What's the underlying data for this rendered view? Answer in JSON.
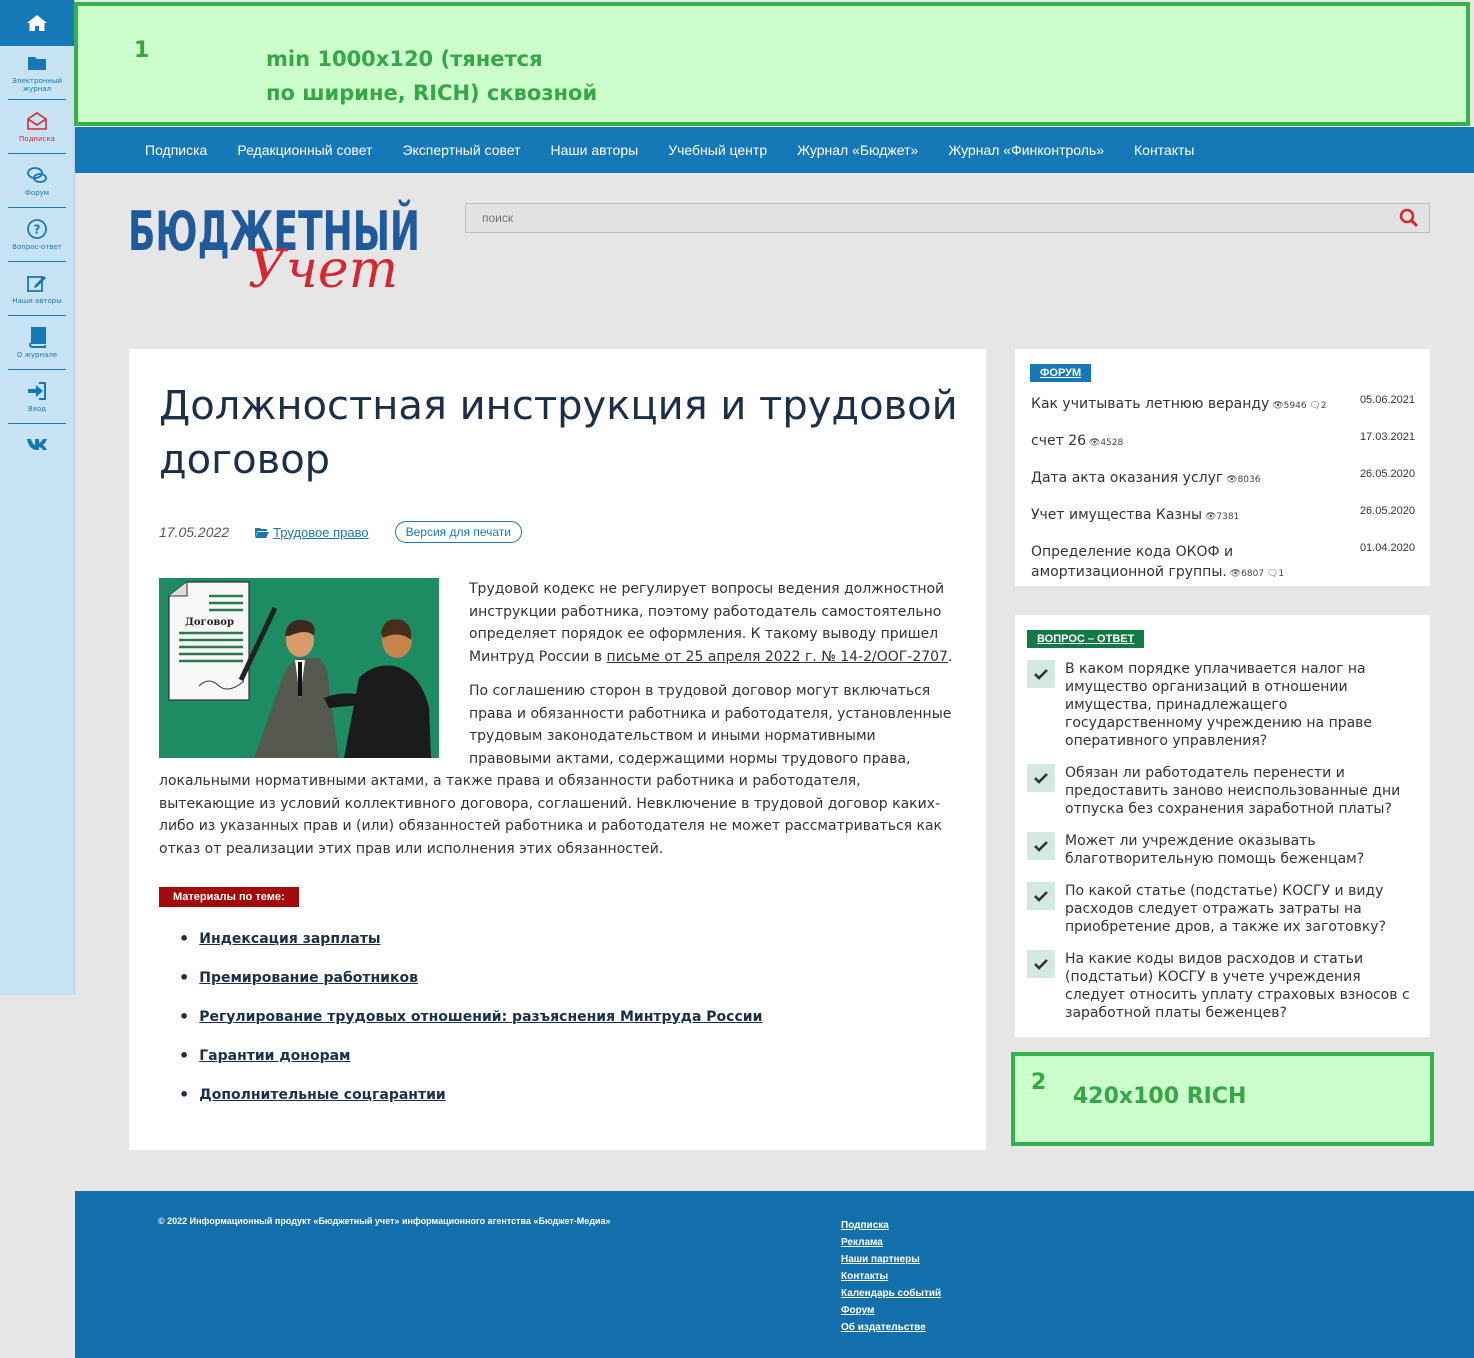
{
  "sidebar": {
    "home_icon": "home-icon",
    "items": [
      {
        "label": "Электронный журнал",
        "icon": "folder-icon"
      },
      {
        "label": "Подписка",
        "icon": "envelope-icon"
      },
      {
        "label": "Форум",
        "icon": "chat-icon"
      },
      {
        "label": "Вопрос-ответ",
        "icon": "question-icon"
      },
      {
        "label": "Наши авторы",
        "icon": "edit-icon"
      },
      {
        "label": "О журнале",
        "icon": "book-icon"
      },
      {
        "label": "Вход",
        "icon": "login-icon"
      }
    ],
    "vk_icon": "vk-icon"
  },
  "banner_top": {
    "number": "1",
    "line1": "min 1000x120 (тянется",
    "line2": "по ширине, RICH)  сквозной"
  },
  "nav": [
    "Подписка",
    "Редакционный совет",
    "Экспертный совет",
    "Наши авторы",
    "Учебный центр",
    "Журнал «Бюджет»",
    "Журнал «Финконтроль»",
    "Контакты"
  ],
  "logo": {
    "word1": "БЮДЖЕТНЫЙ",
    "word2": "Учет"
  },
  "search": {
    "placeholder": "поиск"
  },
  "article": {
    "title": "Должностная инструкция и трудовой договор",
    "date": "17.05.2022",
    "category": "Трудовое право",
    "print_label": "Версия для печати",
    "image_doc_label": "Договор",
    "p1_before_link": "Трудовой кодекс не регулирует вопросы ведения должностной инструкции работника, поэтому работодатель самостоятельно определяет порядок ее оформления. К такому выводу пришел Минтруд России в ",
    "p1_link": "письме от 25 апреля 2022 г. № 14-2/ООГ-2707",
    "p1_after_link": ".",
    "p2": "По соглашению сторон в трудовой договор могут включаться права и обязанности работника и работодателя, установленные трудовым законодательством и иными нормативными правовыми актами, содержащими нормы трудового права, локальными нормативными актами, а также права и обязанности работника и работодателя, вытекающие из условий коллективного договора, соглашений. Невключение в трудовой договор каких-либо из указанных прав и (или) обязанностей работника и работодателя не может рассматриваться как отказ от реализации этих прав или исполнения этих обязанностей.",
    "materials_label": "Материалы по теме:",
    "materials": [
      "Индексация зарплаты",
      "Премирование работников",
      "Регулирование трудовых отношений: разъяснения Минтруда России",
      "Гарантии донорам",
      "Дополнительные соцгарантии"
    ]
  },
  "forum": {
    "tag": "ФОРУМ",
    "items": [
      {
        "title": "Как учитывать летнюю веранду",
        "views": "5946",
        "comments": "2",
        "date": "05.06.2021"
      },
      {
        "title": "счет 26",
        "views": "4528",
        "comments": "",
        "date": "17.03.2021"
      },
      {
        "title": "Дата акта оказания услуг",
        "views": "8036",
        "comments": "",
        "date": "26.05.2020"
      },
      {
        "title": "Учет имущества Казны",
        "views": "7381",
        "comments": "",
        "date": "26.05.2020"
      },
      {
        "title": "Определение кода ОКОФ и амортизационной группы.",
        "views": "6807",
        "comments": "1",
        "date": "01.04.2020"
      }
    ]
  },
  "qa": {
    "tag": "ВОПРОС – ОТВЕТ",
    "items": [
      "В каком порядке уплачивается налог на имущество организаций в отношении имущества, принадлежащего государственному учреждению на праве оперативного управления?",
      "Обязан ли работодатель перенести и предоставить заново неиспользованные дни отпуска без сохранения заработной платы?",
      "Может ли учреждение оказывать благотворительную помощь беженцам?",
      "По какой статье (подстатье) КОСГУ и виду расходов следует отражать затраты на приобретение дров, а также их заготовку?",
      "На какие коды видов расходов и статьи (подстатьи) КОСГУ в учете учреждения следует относить уплату страховых взносов с заработной платы беженцев?"
    ]
  },
  "banner_side": {
    "number": "2",
    "text": "420x100 RICH"
  },
  "footer": {
    "copyright": "© 2022   Информационный продукт «Бюджетный учет» информационного агентства «Бюджет-Медиа»",
    "links": [
      "Подписка",
      "Реклама",
      "Наши партнеры",
      "Контакты",
      "Календарь событий",
      "Форум",
      "Об издательстве"
    ]
  },
  "colors": {
    "brand_blue": "#1778b8",
    "brand_red": "#d6262e",
    "banner_green": "#33b34a",
    "qa_green": "#127a45"
  }
}
